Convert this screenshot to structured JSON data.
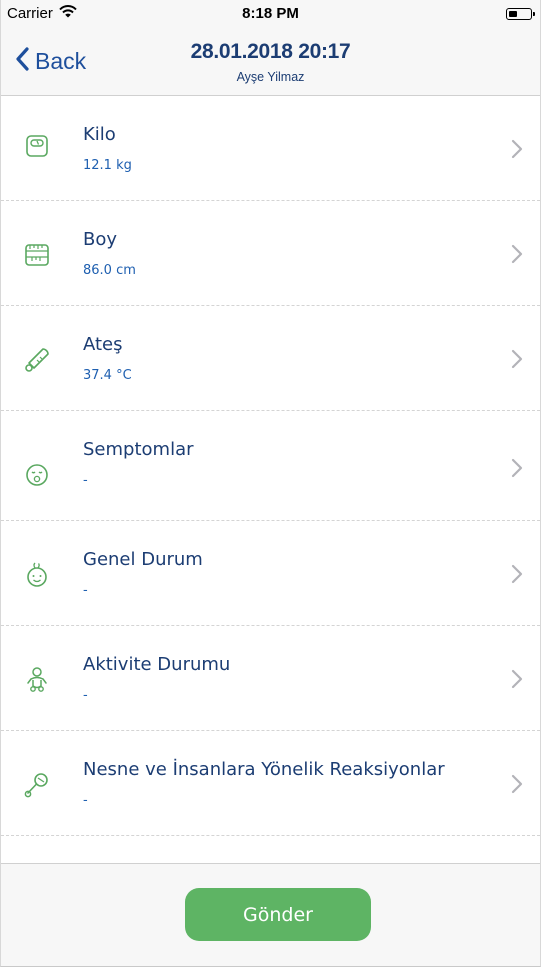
{
  "status_bar": {
    "carrier": "Carrier",
    "time": "8:18 PM",
    "icons": [
      "wifi-icon",
      "battery-icon"
    ]
  },
  "nav": {
    "back_label": "Back",
    "title": "28.01.2018 20:17",
    "subtitle": "Ayşe Yilmaz"
  },
  "rows": [
    {
      "title": "Kilo",
      "value": "12.1 kg",
      "icon": "scale-icon"
    },
    {
      "title": "Boy",
      "value": "86.0 cm",
      "icon": "measuring-tape-icon"
    },
    {
      "title": "Ateş",
      "value": "37.4 °C",
      "icon": "thermometer-icon"
    },
    {
      "title": "Semptomlar",
      "value": "-",
      "icon": "sick-face-icon"
    },
    {
      "title": "Genel Durum",
      "value": "-",
      "icon": "baby-face-icon"
    },
    {
      "title": "Aktivite Durumu",
      "value": "-",
      "icon": "baby-activity-icon"
    },
    {
      "title": "Nesne ve İnsanlara Yönelik Reaksiyonlar",
      "value": "-",
      "icon": "rattle-icon"
    }
  ],
  "footer": {
    "submit_label": "Gönder"
  },
  "colors": {
    "accent": "#5eb464",
    "title_text": "#1c3d73",
    "value_text": "#1e5fb0",
    "link": "#1e4f9c",
    "icon_green": "#5aa860"
  }
}
